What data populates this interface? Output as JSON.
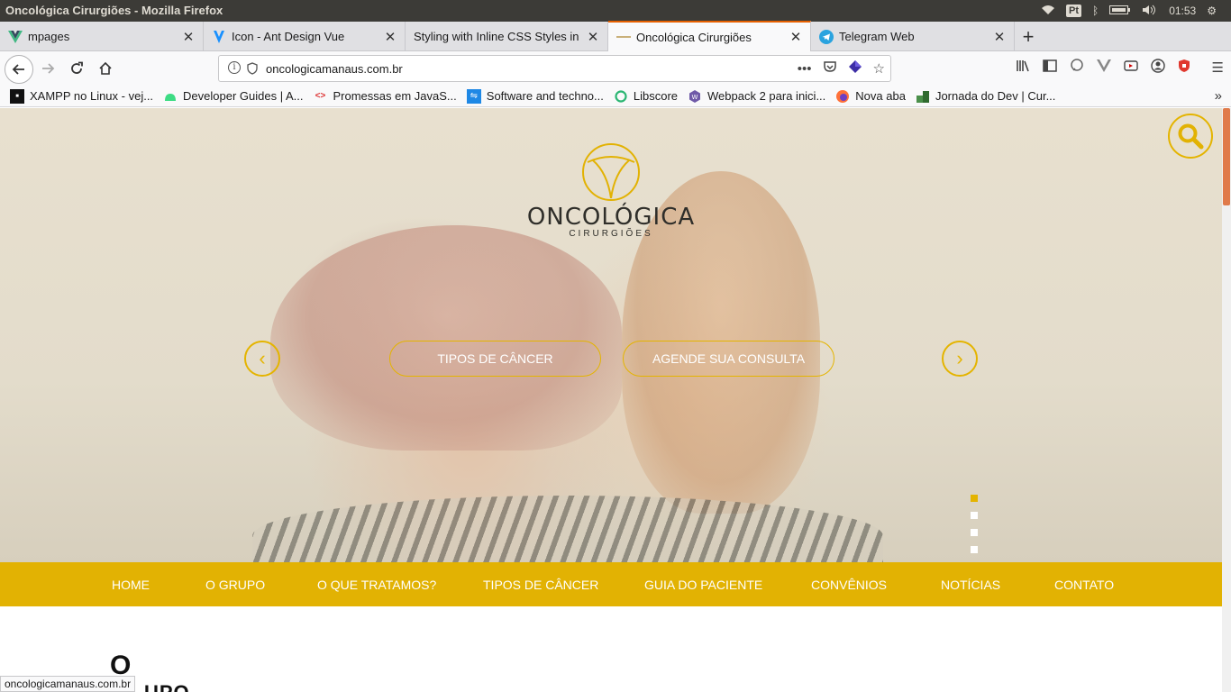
{
  "window": {
    "title": "Oncológica Cirurgiões - Mozilla Firefox",
    "tray": {
      "keyboard": "Pt",
      "time": "01:53"
    }
  },
  "tabs": [
    {
      "label": "mpages",
      "icon": "vue-icon",
      "color": "#41b883"
    },
    {
      "label": "Icon - Ant Design Vue",
      "icon": "ant-design-vue-icon",
      "color": "#1890ff"
    },
    {
      "label": "Styling with Inline CSS Styles in V",
      "icon": "",
      "color": ""
    },
    {
      "label": "Oncológica Cirurgiões",
      "icon": "oncologica-icon",
      "color": "#c9b07a",
      "active": true
    },
    {
      "label": "Telegram Web",
      "icon": "telegram-icon",
      "color": "#2aa3df"
    }
  ],
  "navbar": {
    "url": "oncologicamanaus.com.br"
  },
  "bookmarks": [
    {
      "label": "XAMPP no Linux - vej...",
      "icon": "xampp-icon"
    },
    {
      "label": "Developer Guides | A...",
      "icon": "android-icon"
    },
    {
      "label": "Promessas em JavaS...",
      "icon": "code-icon"
    },
    {
      "label": "Software and techno...",
      "icon": "share-icon"
    },
    {
      "label": "Libscore",
      "icon": "libscore-icon"
    },
    {
      "label": "Webpack 2 para inici...",
      "icon": "webpack-icon"
    },
    {
      "label": "Nova aba",
      "icon": "firefox-icon"
    },
    {
      "label": "Jornada do Dev | Cur...",
      "icon": "jornada-icon"
    }
  ],
  "site": {
    "logo": {
      "word": "ONCOLÓGICA",
      "sub": "CIRURGIÕES"
    },
    "hero_buttons": {
      "tipos": "TIPOS DE CÂNCER",
      "agende": "AGENDE SUA CONSULTA"
    },
    "slider": {
      "slides": 4,
      "active": 1
    },
    "menu": [
      "HOME",
      "O GRUPO",
      "O QUE TRATAMOS?",
      "TIPOS DE CÂNCER",
      "GUIA DO PACIENTE",
      "CONVÊNIOS",
      "NOTÍCIAS",
      "CONTATO"
    ],
    "section_partial": {
      "o": "O",
      "grupo": "UPO"
    },
    "accent": "#e2b203"
  },
  "status_url": "oncologicamanaus.com.br"
}
